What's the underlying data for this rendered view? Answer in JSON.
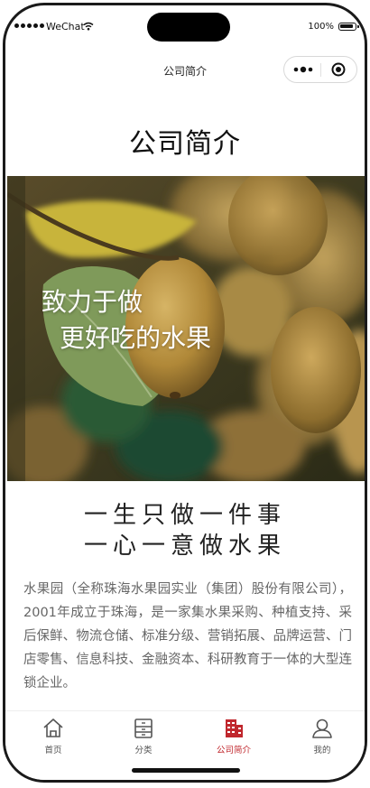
{
  "status_bar": {
    "carrier": "WeChat",
    "battery": "100%"
  },
  "nav": {
    "title": "公司简介",
    "more_icon": "more-dots-icon",
    "close_icon": "mini-program-close-icon"
  },
  "page": {
    "title": "公司简介",
    "hero": {
      "slogan_line1": "致力于做",
      "slogan_line2": "更好吃的水果",
      "image": "kiwifruit-on-vine-photo"
    },
    "motto_line1": "一生只做一件事",
    "motto_line2": "一心一意做水果",
    "intro": "水果园（全称珠海水果园实业（集团）股份有限公司），2001年成立于珠海，是一家集水果采购、种植支持、采后保鲜、物流仓储、标准分级、营销拓展、品牌运营、门店零售、信息科技、金融资本、科研教育于一体的大型连锁企业。"
  },
  "tab_bar": {
    "active_color": "#c0272d",
    "tabs": [
      {
        "label": "首页",
        "icon": "home-icon"
      },
      {
        "label": "分类",
        "icon": "category-icon"
      },
      {
        "label": "公司简介",
        "icon": "company-building-icon",
        "active": true
      },
      {
        "label": "我的",
        "icon": "user-icon"
      }
    ]
  }
}
